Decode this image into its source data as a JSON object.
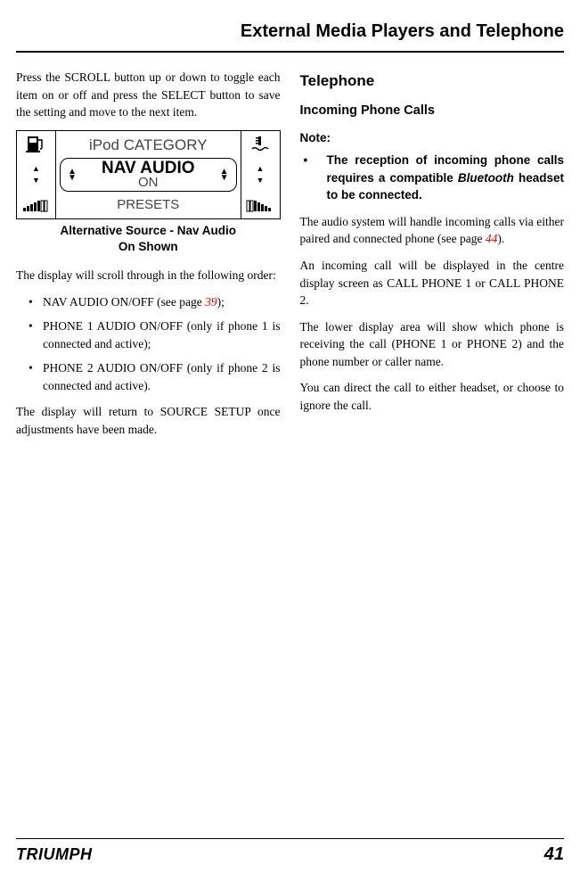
{
  "header": {
    "title": "External Media Players and Telephone"
  },
  "left": {
    "intro": "Press the SCROLL button up or down to toggle each item on or off and press the SELECT button to save the setting and move to the next item.",
    "display": {
      "row1": "iPod CATEGORY",
      "row2main": "NAV AUDIO",
      "row2sub": "ON",
      "row3": "PRESETS"
    },
    "caption_line1": "Alternative Source - Nav Audio",
    "caption_line2": "On Shown",
    "after1": "The display will scroll through in the following order:",
    "bullets": [
      {
        "pre": "NAV AUDIO ON/OFF (see page ",
        "ref": "39",
        "post": ");"
      },
      {
        "text": "PHONE 1 AUDIO ON/OFF (only if phone 1 is connected and active);"
      },
      {
        "text": "PHONE 2 AUDIO ON/OFF (only if phone 2 is connected and active)."
      }
    ],
    "after2": "The display will return to SOURCE SETUP once adjustments have been made."
  },
  "right": {
    "h2": "Telephone",
    "h3": "Incoming Phone Calls",
    "note_head": "Note:",
    "note_pre": "The reception of incoming phone calls requires a compatible ",
    "note_bt": "Bluetooth",
    "note_post": " headset to be connected.",
    "p1_pre": "The audio system will handle incoming calls via either paired and connected phone (see page ",
    "p1_ref": "44",
    "p1_post": ").",
    "p2": "An incoming call will be displayed in the centre display screen as CALL PHONE 1 or CALL PHONE 2.",
    "p3": "The lower display area will show which phone is receiving the call (PHONE 1 or PHONE 2) and the phone number or caller name.",
    "p4": "You can direct the call to either headset, or choose to ignore the call."
  },
  "footer": {
    "logo": "TRIUMPH",
    "page": "41"
  }
}
